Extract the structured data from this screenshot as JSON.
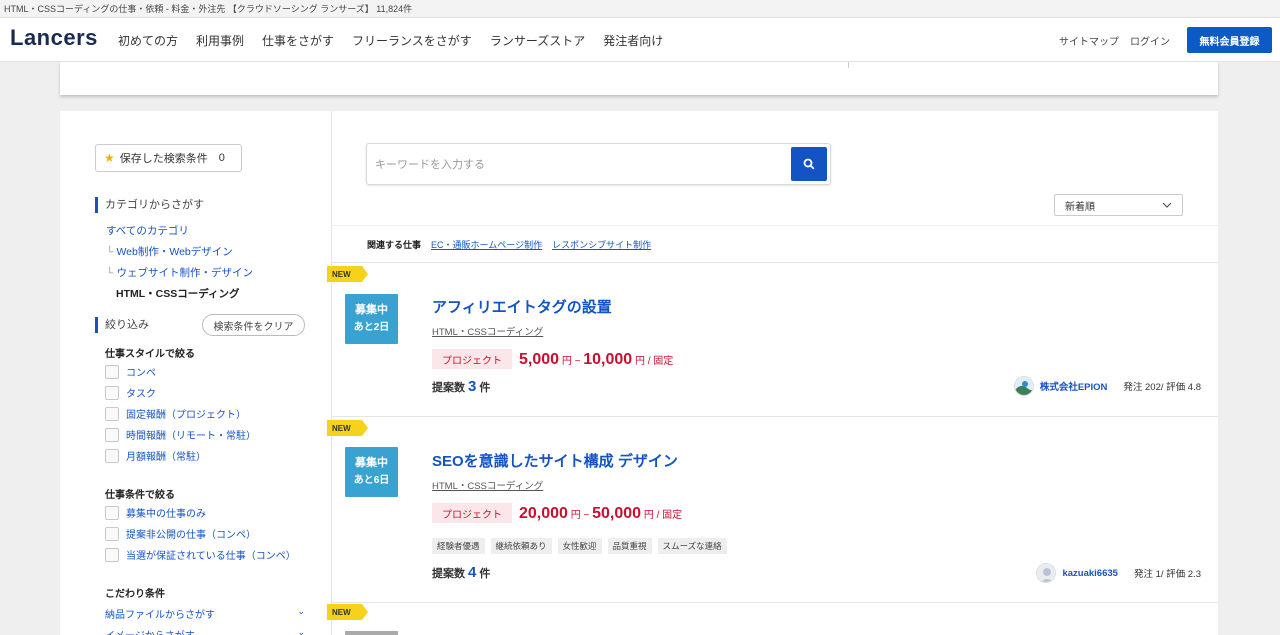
{
  "window": {
    "title": "HTML・CSSコーディングの仕事・依頼 - 料金・外注先 【クラウドソーシング ランサーズ】 11,824件"
  },
  "header": {
    "logo": "Lancers",
    "nav": [
      "初めての方",
      "利用事例",
      "仕事をさがす",
      "フリーランスをさがす",
      "ランサーズストア",
      "発注者向け"
    ],
    "links": [
      "サイトマップ",
      "ログイン"
    ],
    "register_label": "無料会員登録"
  },
  "sidebar": {
    "saved_label": "保存した検索条件",
    "saved_count": "0",
    "category_title": "カテゴリからさがす",
    "categories": [
      "すべてのカテゴリ",
      "Web制作・Webデザイン",
      "ウェブサイト制作・デザイン"
    ],
    "current_category": "HTML・CSSコーディング",
    "filter_title": "絞り込み",
    "clear_label": "検索条件をクリア",
    "style_title": "仕事スタイルで絞る",
    "styles": [
      "コンペ",
      "タスク",
      "固定報酬（プロジェクト）",
      "時間報酬（リモート・常駐）",
      "月額報酬（常駐）"
    ],
    "cond_title": "仕事条件で絞る",
    "conds": [
      "募集中の仕事のみ",
      "提案非公開の仕事（コンペ）",
      "当選が保証されている仕事（コンペ）"
    ],
    "more_title": "こだわり条件",
    "more": [
      "納品ファイルからさがす",
      "イメージからさがす"
    ]
  },
  "search": {
    "placeholder": "キーワードを入力する",
    "value": ""
  },
  "sort": {
    "selected": "新着順"
  },
  "related": {
    "label": "関連する仕事",
    "links": [
      "EC・通販ホームページ制作",
      "レスポンシブサイト制作"
    ]
  },
  "jobs": [
    {
      "new": "NEW",
      "status": "募集中",
      "remaining": "あと2日",
      "title": "アフィリエイトタグの設置",
      "category": "HTML・CSSコーディング",
      "type": "プロジェクト",
      "price_min": "5,000",
      "price_max": "10,000",
      "yen": "円",
      "sep": "~",
      "fixed": "円 / 固定",
      "proposals_label": "提案数",
      "proposals": "3",
      "proposals_unit": "件",
      "client": "株式会社EPION",
      "client_stats": "発注 202/ 評価 4.8",
      "tags": []
    },
    {
      "new": "NEW",
      "status": "募集中",
      "remaining": "あと6日",
      "title": "SEOを意識したサイト構成 デザイン",
      "category": "HTML・CSSコーディング",
      "type": "プロジェクト",
      "price_min": "20,000",
      "price_max": "50,000",
      "yen": "円",
      "sep": "~",
      "fixed": "円 / 固定",
      "proposals_label": "提案数",
      "proposals": "4",
      "proposals_unit": "件",
      "client": "kazuaki6635",
      "client_stats": "発注 1/ 評価 2.3",
      "tags": [
        "経験者優遇",
        "継続依頼あり",
        "女性歓迎",
        "品質重視",
        "スムーズな連絡"
      ]
    },
    {
      "new": "NEW"
    }
  ],
  "colors": {
    "brand": "#1a2b52",
    "accent": "#1453c4",
    "price": "#c8102e",
    "new_badge": "#f6d21a",
    "status": "#3aa2d0"
  }
}
